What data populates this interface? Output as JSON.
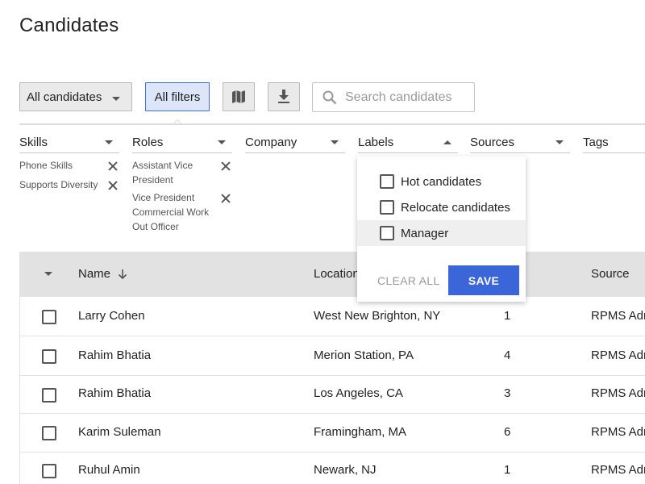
{
  "page": {
    "title": "Candidates"
  },
  "toolbar": {
    "candidates_dropdown": "All candidates",
    "all_filters": "All filters",
    "search_placeholder": "Search candidates"
  },
  "filters": [
    {
      "label": "Skills",
      "open": false
    },
    {
      "label": "Roles",
      "open": false
    },
    {
      "label": "Company",
      "open": false
    },
    {
      "label": "Labels",
      "open": true
    },
    {
      "label": "Sources",
      "open": false
    },
    {
      "label": "Tags",
      "open": false
    }
  ],
  "selected_skills": [
    "Phone Skills",
    "Supports Diversity"
  ],
  "selected_roles": [
    "Assistant Vice President",
    "Vice President Commercial Work Out Officer"
  ],
  "labels_menu": {
    "options": [
      {
        "label": "Hot candidates",
        "checked": false
      },
      {
        "label": "Relocate candidates",
        "checked": false
      },
      {
        "label": "Manager",
        "checked": false
      }
    ],
    "clear_label": "CLEAR ALL",
    "save_label": "SAVE"
  },
  "table": {
    "columns": [
      "Name",
      "Location",
      "Source"
    ],
    "rows": [
      {
        "name": "Larry Cohen",
        "location": "West New Brighton, NY",
        "count": "1",
        "source": "RPMS Admin"
      },
      {
        "name": "Rahim Bhatia",
        "location": "Merion Station, PA",
        "count": "4",
        "source": "RPMS Admin"
      },
      {
        "name": "Rahim Bhatia",
        "location": "Los Angeles, CA",
        "count": "3",
        "source": "RPMS Admin"
      },
      {
        "name": "Karim Suleman",
        "location": "Framingham, MA",
        "count": "6",
        "source": "RPMS Admin"
      },
      {
        "name": "Ruhul Amin",
        "location": "Newark, NJ",
        "count": "1",
        "source": "RPMS Admin"
      }
    ]
  },
  "colors": {
    "accent": "#3a66da",
    "active_filter_bg": "#dce6f8",
    "header_bg": "#e2e2e2"
  },
  "icons": {
    "map": "map-icon",
    "download": "download-icon",
    "search": "search-icon"
  }
}
